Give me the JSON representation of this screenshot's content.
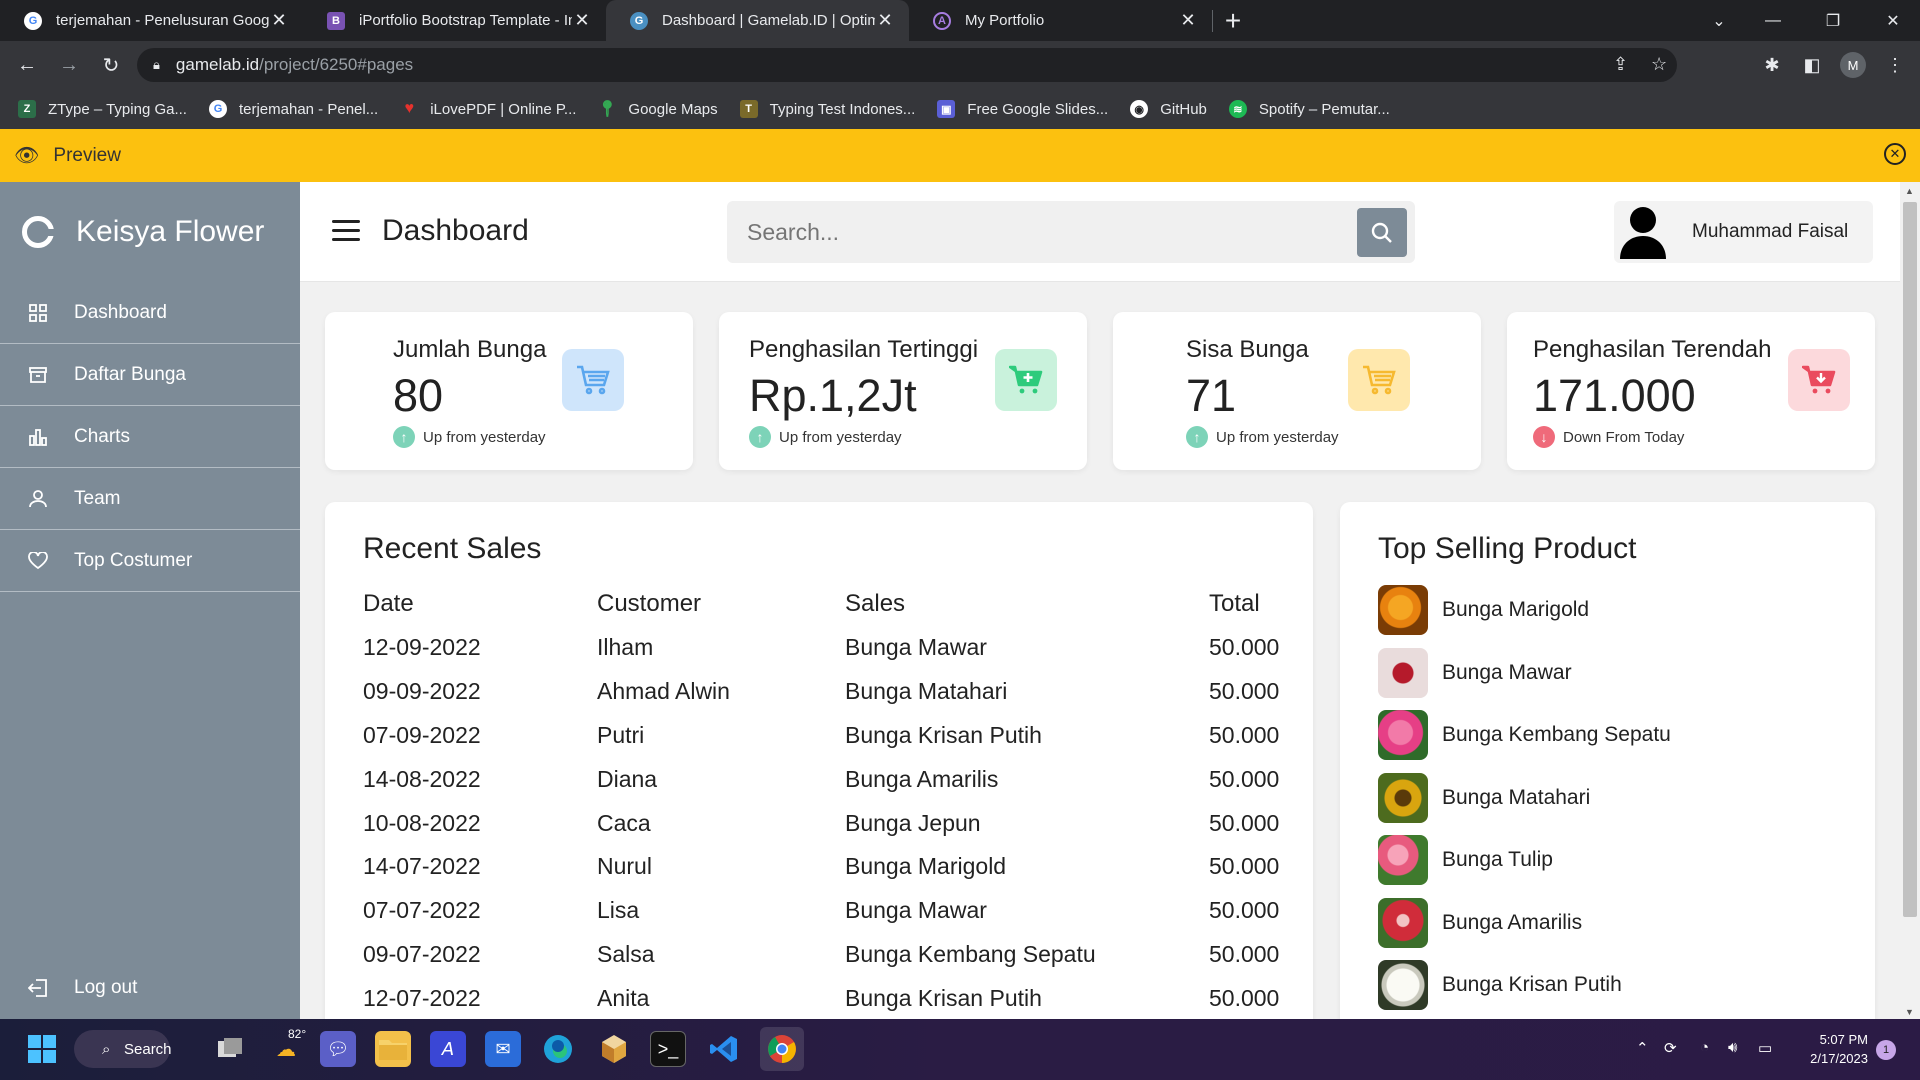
{
  "browser": {
    "tabs": [
      {
        "title": "terjemahan - Penelusuran Google",
        "icon": "google-icon",
        "active": false
      },
      {
        "title": "iPortfolio Bootstrap Template - In",
        "icon": "bootstrap-icon",
        "active": false
      },
      {
        "title": "Dashboard | Gamelab.ID | Optimi",
        "icon": "gamelab-icon",
        "active": true
      },
      {
        "title": "My Portfolio",
        "icon": "react-icon",
        "active": false
      }
    ],
    "url_host": "gamelab.id",
    "url_path": "/project/6250#pages",
    "profile_initial": "M",
    "bookmarks": [
      {
        "label": "ZType – Typing Ga...",
        "color": "#2c6e49"
      },
      {
        "label": "terjemahan - Penel...",
        "color": "#4285f4"
      },
      {
        "label": "iLovePDF | Online P...",
        "color": "#e5322d"
      },
      {
        "label": "Google Maps",
        "color": "#34a853"
      },
      {
        "label": "Typing Test Indones...",
        "color": "#7a6a2a"
      },
      {
        "label": "Free Google Slides...",
        "color": "#5a5fd6"
      },
      {
        "label": "GitHub",
        "color": "#ffffff"
      },
      {
        "label": "Spotify – Pemutar...",
        "color": "#1db954"
      }
    ]
  },
  "preview": {
    "label": "Preview"
  },
  "sidebar": {
    "brand": "Keisya Flower",
    "items": [
      {
        "label": "Dashboard",
        "icon": "grid-icon"
      },
      {
        "label": "Daftar Bunga",
        "icon": "archive-icon"
      },
      {
        "label": "Charts",
        "icon": "bar-chart-icon"
      },
      {
        "label": "Team",
        "icon": "user-icon"
      },
      {
        "label": "Top Costumer",
        "icon": "heart-icon"
      }
    ],
    "logout": "Log out"
  },
  "header": {
    "title": "Dashboard",
    "search_placeholder": "Search...",
    "user_name": "Muhammad Faisal"
  },
  "cards": [
    {
      "label": "Jumlah Bunga",
      "value": "80",
      "trend": "Up from yesterday",
      "direction": "up",
      "icon_bg": "#cfe5fb",
      "icon_color": "#5aa6ee"
    },
    {
      "label": "Penghasilan Tertinggi",
      "value": "Rp.1,2Jt",
      "trend": "Up from yesterday",
      "direction": "up",
      "icon_bg": "#c9f2dc",
      "icon_color": "#2ecb7c"
    },
    {
      "label": "Sisa Bunga",
      "value": "71",
      "trend": "Up from yesterday",
      "direction": "up",
      "icon_bg": "#ffe8ad",
      "icon_color": "#f6b930"
    },
    {
      "label": "Penghasilan Terendah",
      "value": "171.000",
      "trend": "Down From Today",
      "direction": "down",
      "icon_bg": "#fcd9dc",
      "icon_color": "#ea4b5e"
    }
  ],
  "recent_sales": {
    "title": "Recent Sales",
    "columns": [
      "Date",
      "Customer",
      "Sales",
      "Total"
    ],
    "rows": [
      [
        "12-09-2022",
        "Ilham",
        "Bunga Mawar",
        "50.000"
      ],
      [
        "09-09-2022",
        "Ahmad Alwin",
        "Bunga Matahari",
        "50.000"
      ],
      [
        "07-09-2022",
        "Putri",
        "Bunga Krisan Putih",
        "50.000"
      ],
      [
        "14-08-2022",
        "Diana",
        "Bunga Amarilis",
        "50.000"
      ],
      [
        "10-08-2022",
        "Caca",
        "Bunga Jepun",
        "50.000"
      ],
      [
        "14-07-2022",
        "Nurul",
        "Bunga Marigold",
        "50.000"
      ],
      [
        "07-07-2022",
        "Lisa",
        "Bunga Mawar",
        "50.000"
      ],
      [
        "09-07-2022",
        "Salsa",
        "Bunga Kembang Sepatu",
        "50.000"
      ],
      [
        "12-07-2022",
        "Anita",
        "Bunga Krisan Putih",
        "50.000"
      ]
    ]
  },
  "top_selling": {
    "title": "Top Selling Product",
    "products": [
      {
        "name": "Bunga Marigold",
        "color": "#e8820f"
      },
      {
        "name": "Bunga Mawar",
        "color": "#b51a2b"
      },
      {
        "name": "Bunga Kembang Sepatu",
        "color": "#e63f86"
      },
      {
        "name": "Bunga Matahari",
        "color": "#d9a50f"
      },
      {
        "name": "Bunga Tulip",
        "color": "#e85a7e"
      },
      {
        "name": "Bunga Amarilis",
        "color": "#d02c3a"
      },
      {
        "name": "Bunga Krisan Putih",
        "color": "#e8e8e0"
      }
    ]
  },
  "taskbar": {
    "search_label": "Search",
    "weather": "82°",
    "time": "5:07 PM",
    "date": "2/17/2023",
    "notifications": "1"
  }
}
